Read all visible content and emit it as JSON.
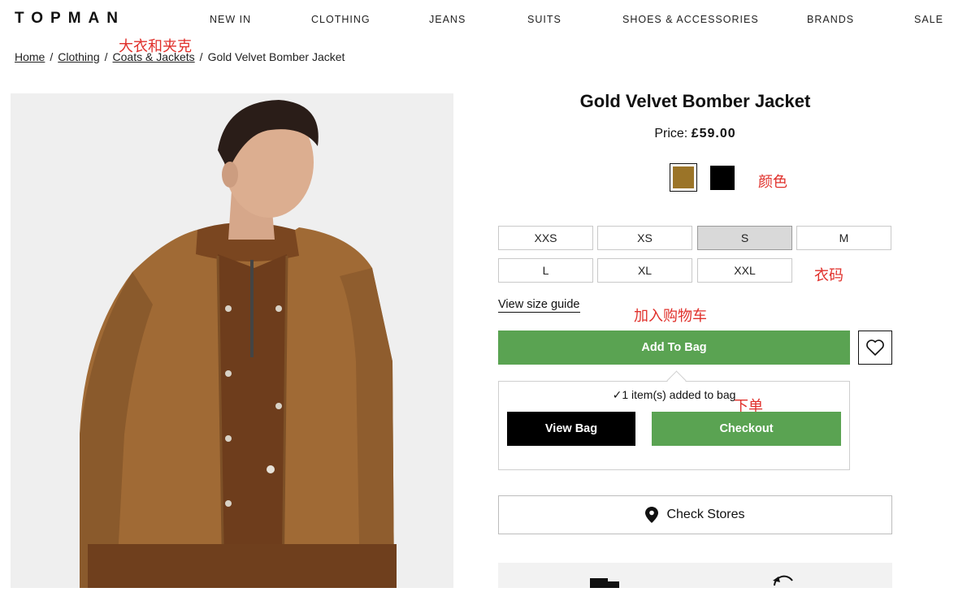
{
  "header": {
    "logo": "TOPMAN",
    "nav": [
      "NEW IN",
      "CLOTHING",
      "JEANS",
      "SUITS",
      "SHOES & ACCESSORIES",
      "BRANDS",
      "SALE"
    ]
  },
  "breadcrumb": {
    "items": [
      "Home",
      "Clothing",
      "Coats & Jackets"
    ],
    "current": "Gold Velvet Bomber Jacket",
    "separator": "/"
  },
  "product": {
    "title": "Gold Velvet Bomber Jacket",
    "price_label": "Price:",
    "price_value": "£59.00",
    "colors": [
      {
        "name": "gold",
        "hex": "#9b7428",
        "selected": true
      },
      {
        "name": "black",
        "hex": "#000000",
        "selected": false
      }
    ],
    "sizes": [
      "XXS",
      "XS",
      "S",
      "M",
      "L",
      "XL",
      "XXL"
    ],
    "selected_size": "S",
    "size_guide_label": "View size guide",
    "add_button": "Add To Bag",
    "wishlist_icon": "heart-icon"
  },
  "bag_popup": {
    "message": "✓1 item(s) added to bag",
    "view_bag": "View Bag",
    "checkout": "Checkout"
  },
  "check_stores": {
    "label": "Check Stores",
    "icon": "location-pin-icon"
  },
  "annotations": {
    "coats": "大衣和夹克",
    "color": "颜色",
    "size": "衣码",
    "add_to_cart": "加入购物车",
    "order": "下单"
  },
  "colors": {
    "accent_green": "#5aa352",
    "annotation_red": "#e0302b"
  }
}
